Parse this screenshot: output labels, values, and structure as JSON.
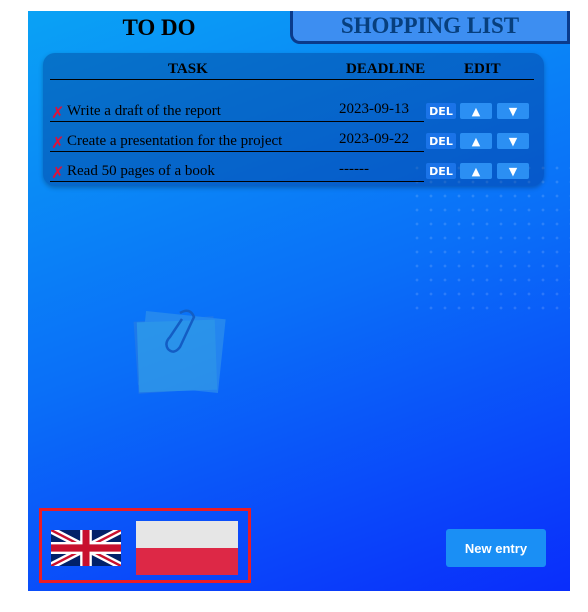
{
  "tabs": {
    "todo": "TO DO",
    "shopping": "SHOPPING LIST"
  },
  "table": {
    "headers": {
      "task": "TASK",
      "deadline": "DEADLINE",
      "edit": "EDIT"
    },
    "rows": [
      {
        "mark": "✗",
        "task": "Write a draft of the report",
        "deadline": "2023-09-13"
      },
      {
        "mark": "✗",
        "task": "Create a presentation for the project",
        "deadline": "2023-09-22"
      },
      {
        "mark": "✗",
        "task": "Read 50 pages of a book",
        "deadline": "------"
      }
    ],
    "buttons": {
      "delete": "DEL",
      "up": "▲",
      "down": "▼"
    }
  },
  "languages": {
    "english": "flag-uk-icon",
    "polish": "flag-pl-icon"
  },
  "actions": {
    "new_entry": "New entry"
  },
  "colors": {
    "background_top": "#0aa2f5",
    "background_bottom": "#0a2dfb",
    "delete_mark": "#e0103a",
    "button": "#1a8ff5"
  }
}
